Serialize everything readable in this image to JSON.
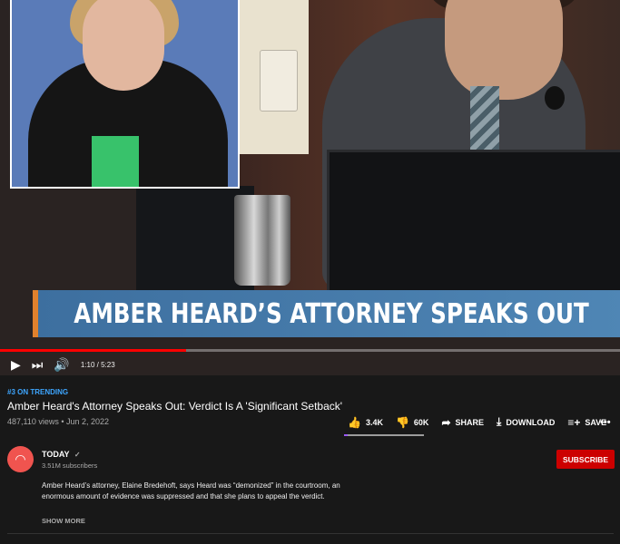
{
  "video": {
    "banner_text": "AMBER HEARD’S ATTORNEY SPEAKS OUT",
    "progress": 0.3,
    "time_display": "1:10 / 5:23"
  },
  "controls": {
    "play_icon": "play-icon",
    "next_icon": "next-icon",
    "volume_icon": "volume-icon"
  },
  "meta": {
    "trending": "#3 ON TRENDING",
    "title": "Amber Heard's Attorney Speaks Out: Verdict Is A 'Significant Setback'",
    "views_date": "487,110 views • Jun 2, 2022"
  },
  "actions": {
    "likes": "3.4K",
    "dislikes": "60K",
    "share": "SHARE",
    "download": "DOWNLOAD",
    "save": "SAVE",
    "more": "•••",
    "like_ratio": 0.05
  },
  "channel": {
    "name": "TODAY",
    "verified": "✓",
    "subscribers": "3.51M subscribers",
    "subscribe_label": "SUBSCRIBE"
  },
  "description": {
    "text": "Amber Heard’s attorney, Elaine Bredehoft, says Heard was “demonized” in the courtroom, an enormous amount of evidence was suppressed and that she plans to appeal the verdict.",
    "show_more": "SHOW MORE"
  },
  "colors": {
    "accent_red": "#ff0000",
    "subscribe": "#cc0000",
    "link_blue": "#3ea6ff",
    "background": "#181818"
  }
}
